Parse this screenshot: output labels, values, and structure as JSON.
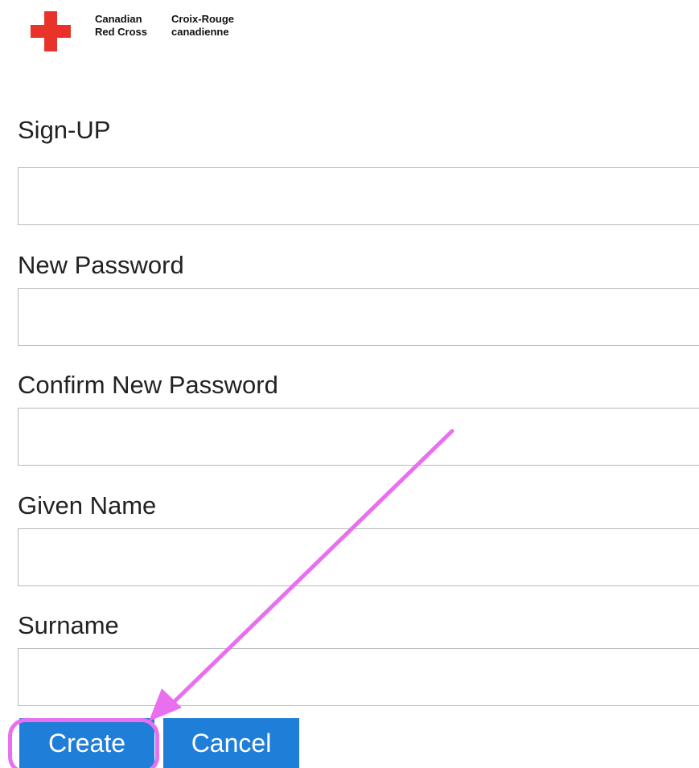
{
  "header": {
    "logo_en_line1": "Canadian",
    "logo_en_line2": "Red Cross",
    "logo_fr_line1": "Croix-Rouge",
    "logo_fr_line2": "canadienne"
  },
  "form": {
    "title": "Sign-UP",
    "fields": [
      {
        "label": "",
        "value": ""
      },
      {
        "label": "New Password",
        "value": ""
      },
      {
        "label": "Confirm New Password",
        "value": ""
      },
      {
        "label": "Given Name",
        "value": ""
      },
      {
        "label": "Surname",
        "value": ""
      }
    ]
  },
  "buttons": {
    "create": "Create",
    "cancel": "Cancel"
  },
  "colors": {
    "brand_red": "#e8322a",
    "button_blue": "#1f7ed8",
    "annotation_pink": "#e96ef0"
  }
}
